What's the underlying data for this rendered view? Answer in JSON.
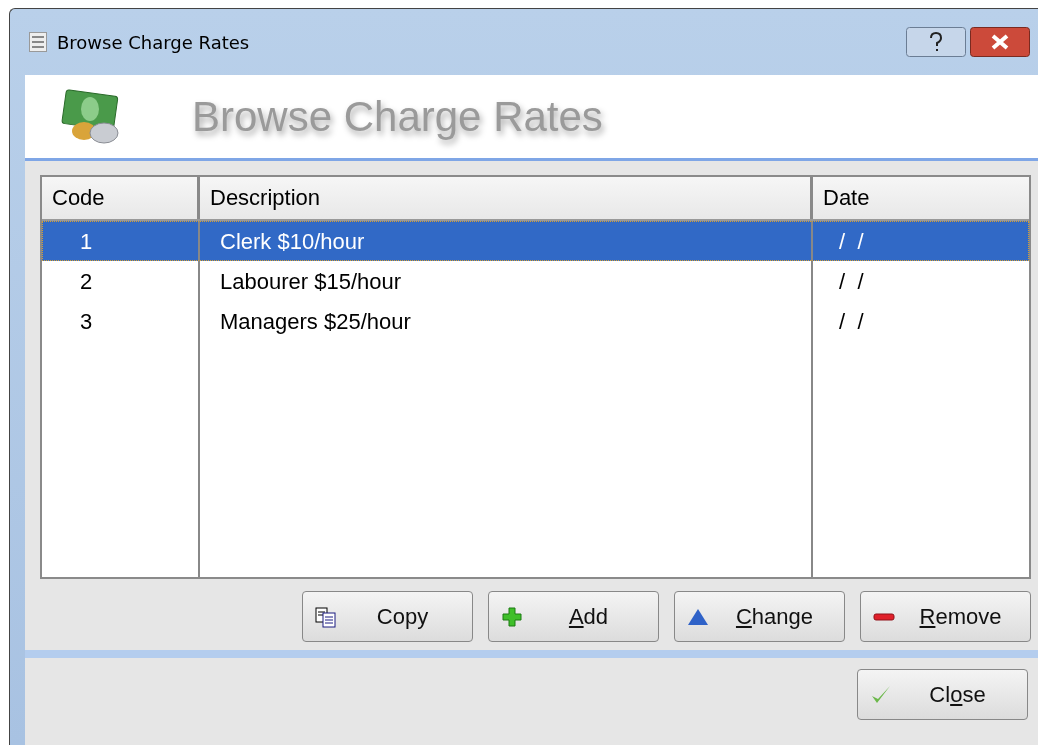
{
  "window": {
    "title": "Browse Charge Rates"
  },
  "header": {
    "title": "Browse Charge Rates"
  },
  "table": {
    "columns": [
      "Code",
      "Description",
      "Date"
    ],
    "rows": [
      {
        "cells": [
          "1",
          "Clerk $10/hour",
          " /  /"
        ],
        "selected": true
      },
      {
        "cells": [
          "2",
          "Labourer $15/hour",
          " /  /"
        ],
        "selected": false
      },
      {
        "cells": [
          "3",
          "Managers $25/hour",
          " /  /"
        ],
        "selected": false
      }
    ]
  },
  "actions": [
    {
      "kind": "copy",
      "pre": "Copy"
    },
    {
      "kind": "add",
      "key": "A",
      "post": "dd"
    },
    {
      "kind": "change",
      "key": "C",
      "post": "hange"
    },
    {
      "kind": "remove",
      "key": "R",
      "post": "emove"
    }
  ],
  "close": {
    "kind": "close",
    "pre": "Cl",
    "key": "o",
    "post": "se"
  }
}
